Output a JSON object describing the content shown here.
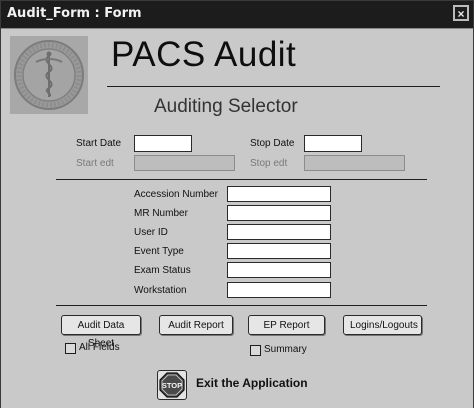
{
  "window": {
    "title": "Audit_Form : Form",
    "close_glyph": "×"
  },
  "logo": {
    "icon": "university-seal-icon"
  },
  "header": {
    "title": "PACS Audit",
    "subtitle": "Auditing Selector"
  },
  "dates": {
    "start_label": "Start Date",
    "stop_label": "Stop Date",
    "start_edit_label": "Start edt",
    "stop_edit_label": "Stop edt",
    "start_value": "",
    "stop_value": "",
    "start_edit_value": "",
    "stop_edit_value": ""
  },
  "filters": [
    {
      "label": "Accession Number",
      "value": ""
    },
    {
      "label": "MR Number",
      "value": ""
    },
    {
      "label": "User ID",
      "value": ""
    },
    {
      "label": "Event Type",
      "value": ""
    },
    {
      "label": "Exam Status",
      "value": ""
    },
    {
      "label": "Workstation",
      "value": ""
    }
  ],
  "buttons": {
    "audit_data_sheet": "Audit Data Sheet",
    "audit_report": "Audit Report",
    "ep_report": "EP Report",
    "logins_logouts": "Logins/Logouts"
  },
  "options": {
    "all_fields_label": "All Fields",
    "all_fields_checked": false,
    "summary_label": "Summary",
    "summary_checked": false
  },
  "exit": {
    "label": "Exit the Application",
    "icon": "stop-sign-icon",
    "icon_text": "STOP"
  }
}
